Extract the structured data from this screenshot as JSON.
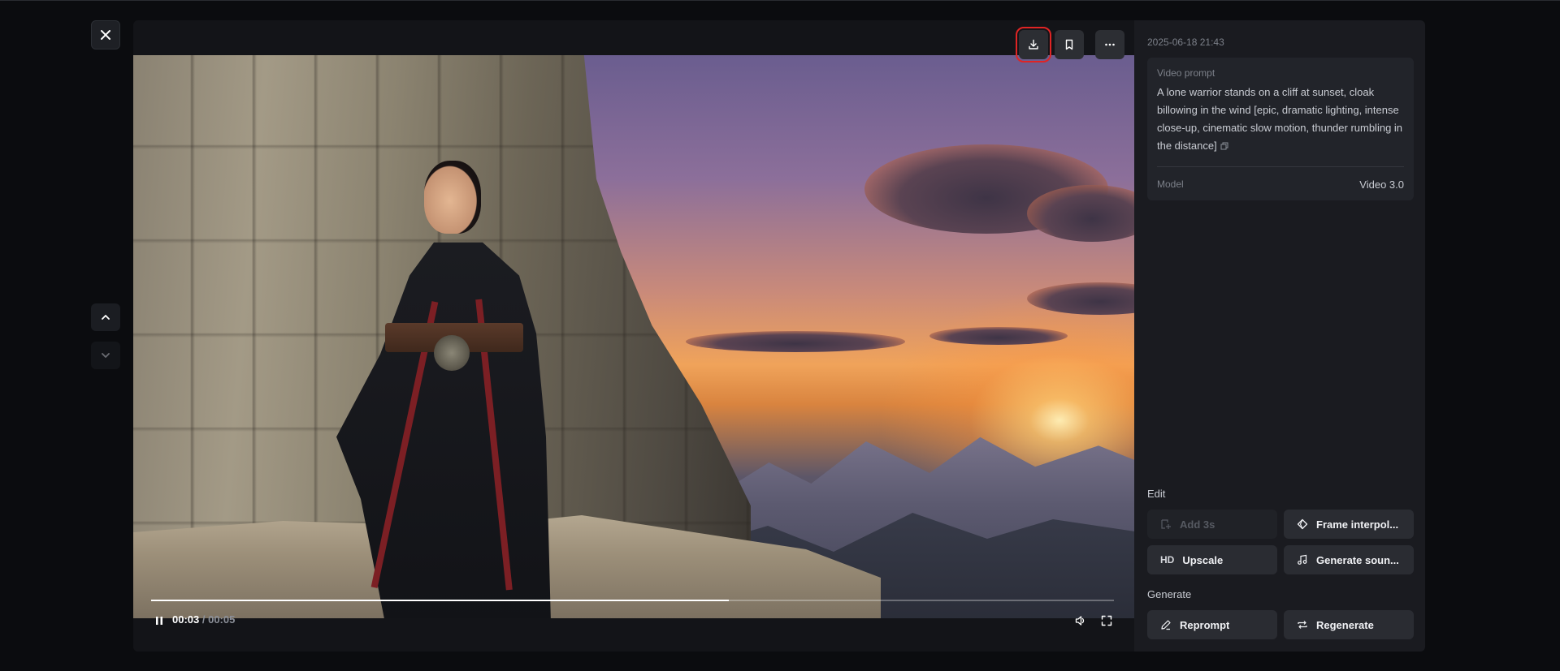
{
  "window": {
    "close_icon": "close-icon"
  },
  "nav": {
    "up_icon": "chevron-up-icon",
    "down_icon": "chevron-down-icon"
  },
  "player": {
    "toolbar": {
      "download_icon": "download-icon",
      "bookmark_icon": "bookmark-icon",
      "more_icon": "more-horizontal-icon",
      "highlight_color": "#e02424"
    },
    "current_time": "00:03",
    "separator": " / ",
    "duration": "00:05",
    "progress": 0.6,
    "state": "playing"
  },
  "details": {
    "timestamp": "2025-06-18 21:43",
    "prompt_label": "Video prompt",
    "prompt_text": "A lone warrior stands on a cliff at sunset, cloak billowing in the wind [epic, dramatic lighting, intense close-up, cinematic slow motion, thunder rumbling in the distance]",
    "model_label": "Model",
    "model_value": "Video 3.0"
  },
  "edit": {
    "section_label": "Edit",
    "buttons": [
      {
        "label": "Add 3s",
        "icon": "add-frame-icon",
        "disabled": true
      },
      {
        "label": "Frame interpol...",
        "icon": "diamond-interpolation-icon",
        "disabled": false
      },
      {
        "label": "Upscale",
        "icon": "hd-icon",
        "badge": "HD",
        "disabled": false
      },
      {
        "label": "Generate soun...",
        "icon": "music-note-icon",
        "disabled": false
      }
    ]
  },
  "generate": {
    "section_label": "Generate",
    "buttons": [
      {
        "label": "Reprompt",
        "icon": "pencil-icon"
      },
      {
        "label": "Regenerate",
        "icon": "repeat-icon"
      }
    ]
  },
  "colors": {
    "background": "#0b0c0f",
    "panel": "#1a1b20",
    "card": "#22242a",
    "button": "#2a2c32"
  }
}
